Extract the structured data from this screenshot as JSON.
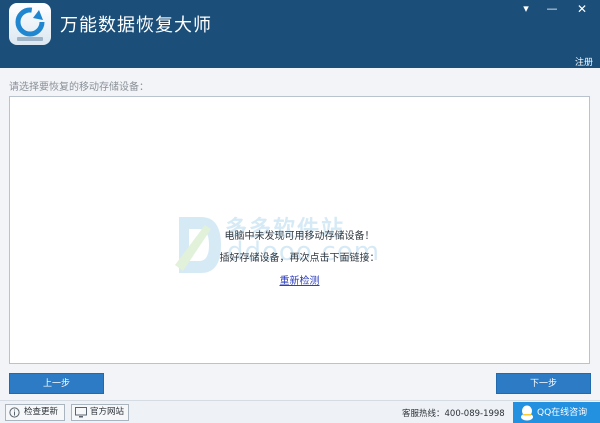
{
  "window": {
    "title": "万能数据恢复大师",
    "controls": {
      "dropdown": "▾",
      "minimize": "—",
      "close": "✕"
    },
    "register_label": "注册"
  },
  "main": {
    "prompt": "请选择要恢复的移动存储设备：",
    "empty_message_1": "电脑中未发现可用移动存储设备！",
    "empty_message_2": "插好存储设备，再次点击下面链接：",
    "redetect_label": "重新检测",
    "prev_label": "上一步",
    "next_label": "下一步"
  },
  "watermark": {
    "cn": "多多软件站",
    "en": "ddooo.com"
  },
  "statusbar": {
    "update_label": "检查更新",
    "website_label": "官方网站",
    "hotline": "客服热线：400-089-1998",
    "qq_label": "QQ在线咨询"
  },
  "colors": {
    "titlebar": "#1b4f7a",
    "button": "#2d7bc4",
    "qq_button": "#2390e0"
  }
}
